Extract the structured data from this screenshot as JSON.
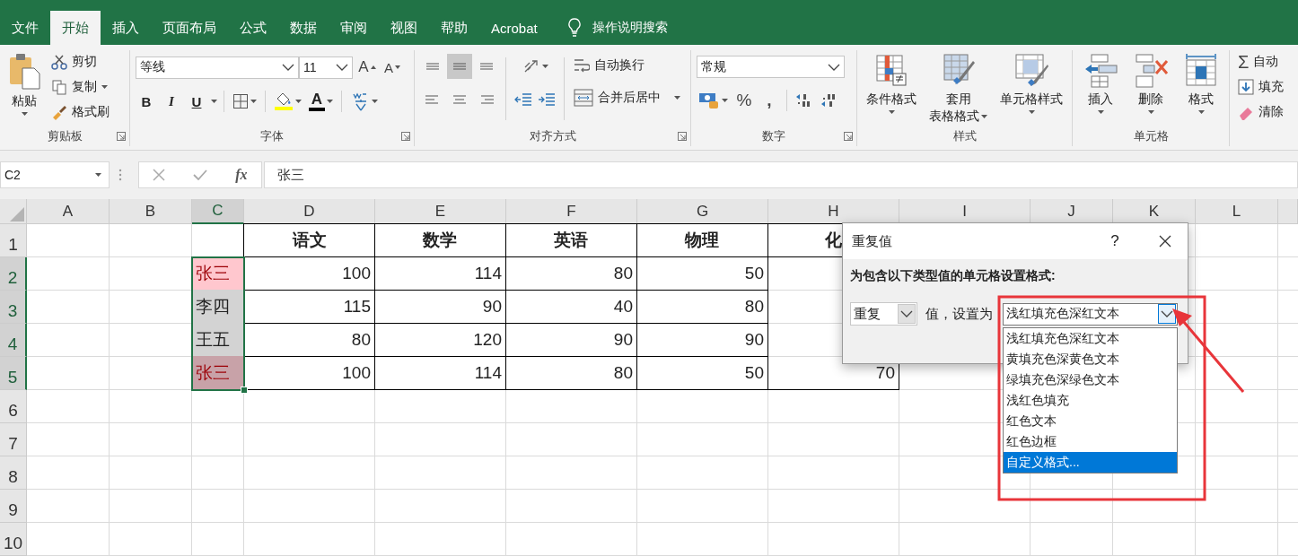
{
  "tabs": [
    {
      "label": "文件",
      "selected": false
    },
    {
      "label": "开始",
      "selected": true
    },
    {
      "label": "插入",
      "selected": false
    },
    {
      "label": "页面布局",
      "selected": false
    },
    {
      "label": "公式",
      "selected": false
    },
    {
      "label": "数据",
      "selected": false
    },
    {
      "label": "审阅",
      "selected": false
    },
    {
      "label": "视图",
      "selected": false
    },
    {
      "label": "帮助",
      "selected": false
    },
    {
      "label": "Acrobat",
      "selected": false
    }
  ],
  "search": "操作说明搜索",
  "ribbon": {
    "clipboard": {
      "label": "剪贴板",
      "paste": "粘贴",
      "cut": "剪切",
      "copy": "复制",
      "painter": "格式刷"
    },
    "font": {
      "label": "字体",
      "name": "等线",
      "size": "11",
      "grow": "A",
      "shrink": "A",
      "bold": "B",
      "italic": "I",
      "underline": "U",
      "color_button": "A"
    },
    "alignment": {
      "label": "对齐方式",
      "valign": [
        {
          "selected": false
        },
        {
          "selected": true
        },
        {
          "selected": false
        }
      ],
      "wrap": "自动换行",
      "merge": "合并后居中"
    },
    "number": {
      "label": "数字",
      "format": "常规",
      "percent": "%",
      "comma": ","
    },
    "styles": {
      "label": "样式",
      "buttons": [
        {
          "kind": "conditional",
          "lines": [
            "条件格式"
          ]
        },
        {
          "kind": "table",
          "lines": [
            "套用",
            "表格格式"
          ]
        },
        {
          "kind": "cellstyle",
          "lines": [
            "单元格样式"
          ]
        }
      ]
    },
    "cells": {
      "label": "单元格",
      "buttons": [
        {
          "kind": "insert",
          "label": "插入"
        },
        {
          "kind": "delete",
          "label": "删除"
        },
        {
          "kind": "format",
          "label": "格式"
        }
      ]
    },
    "editing": {
      "sigma": "Σ",
      "autosum": "自动",
      "fill": "填充",
      "clear": "清除"
    }
  },
  "formula_bar": {
    "name_box": "C2",
    "fx": "fx",
    "content": "张三"
  },
  "grid": {
    "columns": [
      {
        "label": "A",
        "selected": false
      },
      {
        "label": "B",
        "selected": false
      },
      {
        "label": "C",
        "selected": true
      },
      {
        "label": "D",
        "selected": false
      },
      {
        "label": "E",
        "selected": false
      },
      {
        "label": "F",
        "selected": false
      },
      {
        "label": "G",
        "selected": false
      },
      {
        "label": "H",
        "selected": false
      },
      {
        "label": "I",
        "selected": false
      },
      {
        "label": "J",
        "selected": false
      },
      {
        "label": "K",
        "selected": false
      },
      {
        "label": "L",
        "selected": false
      }
    ],
    "rows": [
      {
        "label": "1",
        "selected": false,
        "cells": {
          "D": {
            "kind": "header",
            "text": "语文"
          },
          "E": {
            "kind": "header",
            "text": "数学"
          },
          "F": {
            "kind": "header",
            "text": "英语"
          },
          "G": {
            "kind": "header",
            "text": "物理"
          },
          "H": {
            "kind": "header",
            "text": "化"
          }
        }
      },
      {
        "label": "2",
        "selected": true,
        "cells": {
          "C": {
            "kind": "name",
            "text": "张三",
            "duplicate": true,
            "shaded": false
          },
          "D": {
            "kind": "number",
            "text": "100"
          },
          "E": {
            "kind": "number",
            "text": "114"
          },
          "F": {
            "kind": "number",
            "text": "80"
          },
          "G": {
            "kind": "number",
            "text": "50"
          }
        }
      },
      {
        "label": "3",
        "selected": true,
        "cells": {
          "C": {
            "kind": "name",
            "text": "李四",
            "duplicate": false,
            "shaded": true
          },
          "D": {
            "kind": "number",
            "text": "115"
          },
          "E": {
            "kind": "number",
            "text": "90"
          },
          "F": {
            "kind": "number",
            "text": "40"
          },
          "G": {
            "kind": "number",
            "text": "80"
          }
        }
      },
      {
        "label": "4",
        "selected": true,
        "cells": {
          "C": {
            "kind": "name",
            "text": "王五",
            "duplicate": false,
            "shaded": true
          },
          "D": {
            "kind": "number",
            "text": "80"
          },
          "E": {
            "kind": "number",
            "text": "120"
          },
          "F": {
            "kind": "number",
            "text": "90"
          },
          "G": {
            "kind": "number",
            "text": "90"
          }
        }
      },
      {
        "label": "5",
        "selected": true,
        "cells": {
          "C": {
            "kind": "name",
            "text": "张三",
            "duplicate": true,
            "shaded": true
          },
          "D": {
            "kind": "number",
            "text": "100"
          },
          "E": {
            "kind": "number",
            "text": "114"
          },
          "F": {
            "kind": "number",
            "text": "80"
          },
          "G": {
            "kind": "number",
            "text": "50"
          },
          "H": {
            "kind": "number",
            "text": "70"
          }
        }
      },
      {
        "label": "6",
        "selected": false
      },
      {
        "label": "7",
        "selected": false
      },
      {
        "label": "8",
        "selected": false
      },
      {
        "label": "9",
        "selected": false
      },
      {
        "label": "10",
        "selected": false
      }
    ]
  },
  "dialog": {
    "title": "重复值",
    "help": "?",
    "prompt": "为包含以下类型值的单元格设置格式:",
    "type_select": "重复",
    "between": "值，设置为",
    "format_select": "浅红填充色深红文本",
    "open": true,
    "options": [
      {
        "label": "浅红填充色深红文本",
        "selected": false
      },
      {
        "label": "黄填充色深黄色文本",
        "selected": false
      },
      {
        "label": "绿填充色深绿色文本",
        "selected": false
      },
      {
        "label": "浅红色填充",
        "selected": false
      },
      {
        "label": "红色文本",
        "selected": false
      },
      {
        "label": "红色边框",
        "selected": false
      },
      {
        "label": "自定义格式...",
        "selected": true
      }
    ]
  }
}
